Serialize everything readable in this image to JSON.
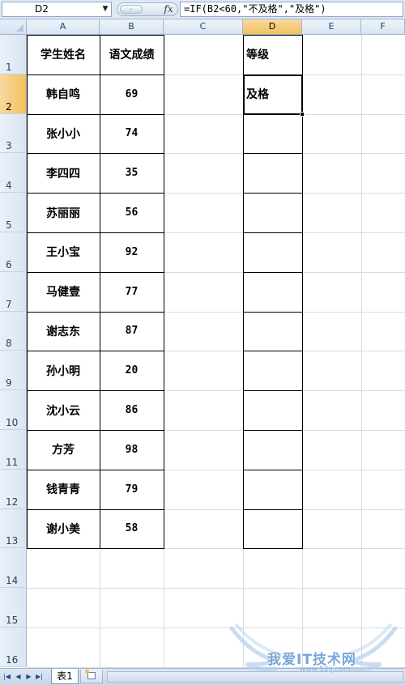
{
  "formula_bar": {
    "name_box": "D2",
    "formula": "=IF(B2<60,\"不及格\",\"及格\")",
    "fx_label": "fx"
  },
  "columns": [
    "A",
    "B",
    "C",
    "D",
    "E",
    "F"
  ],
  "active_column": "D",
  "rows": [
    "1",
    "2",
    "3",
    "4",
    "5",
    "6",
    "7",
    "8",
    "9",
    "10",
    "11",
    "12",
    "13",
    "14",
    "15",
    "16"
  ],
  "active_row": "2",
  "table": {
    "header_name": "学生姓名",
    "header_score": "语文成绩",
    "header_grade": "等级",
    "students": [
      {
        "name": "韩自鸣",
        "score": "69",
        "grade": "及格"
      },
      {
        "name": "张小小",
        "score": "74",
        "grade": ""
      },
      {
        "name": "李四四",
        "score": "35",
        "grade": ""
      },
      {
        "name": "苏丽丽",
        "score": "56",
        "grade": ""
      },
      {
        "name": "王小宝",
        "score": "92",
        "grade": ""
      },
      {
        "name": "马健壹",
        "score": "77",
        "grade": ""
      },
      {
        "name": "谢志东",
        "score": "87",
        "grade": ""
      },
      {
        "name": "孙小明",
        "score": "20",
        "grade": ""
      },
      {
        "name": "沈小云",
        "score": "86",
        "grade": ""
      },
      {
        "name": "方芳",
        "score": "98",
        "grade": ""
      },
      {
        "name": "钱青青",
        "score": "79",
        "grade": ""
      },
      {
        "name": "谢小美",
        "score": "58",
        "grade": ""
      }
    ]
  },
  "sheet_tabs": {
    "active": "表1"
  },
  "watermark": {
    "text": "我爱IT技术网",
    "url": "www.52ij.com"
  }
}
